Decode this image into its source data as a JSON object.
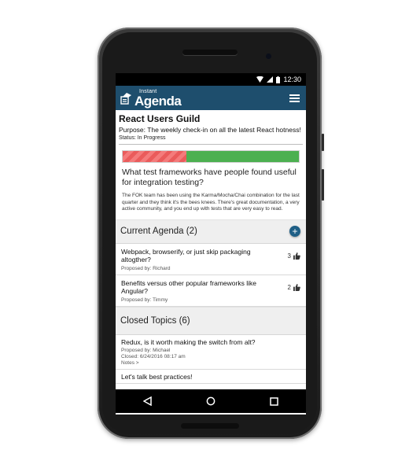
{
  "status_bar": {
    "time": "12:30"
  },
  "app": {
    "logo_small": "Instant",
    "logo_big": "Agenda"
  },
  "meeting": {
    "title": "React Users Guild",
    "purpose": "Purpose: The weekly check-in on all the latest React hotness!",
    "status": "Status: In Progress",
    "progress_fraction": 0.36,
    "colors": {
      "progress_elapsed": "#ea5b5b",
      "progress_remaining": "#4cb050",
      "appbar": "#1e4e6d",
      "fab": "#1f5f86"
    }
  },
  "current_topic": {
    "title": "What test frameworks have people found useful for integration testing?",
    "body": "The FOK team has been using the Karma/Mocha/Chai combination for the last quarter and they think it's the bees knees. There's great documentation, a very active community, and you end up with tests that are very easy to read."
  },
  "current_agenda": {
    "heading": "Current Agenda (2)",
    "add_icon": "plus-icon",
    "items": [
      {
        "title": "Webpack, browserify, or just skip packaging altogther?",
        "proposer": "Proposed by:  Richard",
        "votes": "3"
      },
      {
        "title": "Benefits versus other popular frameworks like Angular?",
        "proposer": "Proposed by:  Timmy",
        "votes": "2"
      }
    ]
  },
  "closed_topics": {
    "heading": "Closed Topics (6)",
    "items": [
      {
        "title": "Redux, is it worth making the switch from alt?",
        "proposer": "Proposed by:  Michael",
        "closed": "Closed: 6/24/2016 08:17 am",
        "notes": "Notes >"
      },
      {
        "title": "Let's talk best practices!"
      }
    ]
  },
  "nav": {
    "back_icon": "back-triangle-icon",
    "home_icon": "home-circle-icon",
    "recents_icon": "recents-square-icon"
  }
}
